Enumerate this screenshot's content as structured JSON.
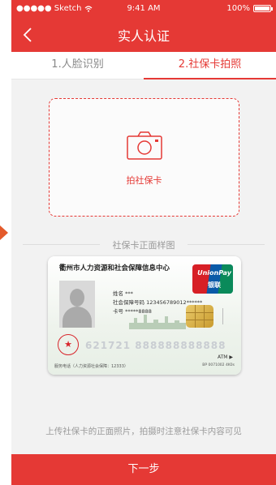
{
  "status_bar": {
    "carrier": "●●●●● Sketch",
    "time": "9:41 AM",
    "battery": "100%"
  },
  "nav": {
    "title": "实人认证"
  },
  "tabs": [
    {
      "label": "1.人脸识别",
      "active": false
    },
    {
      "label": "2.社保卡拍照",
      "active": true
    }
  ],
  "upload": {
    "label": "拍社保卡"
  },
  "sample": {
    "label": "社保卡正面样图",
    "card": {
      "issuer": "衢州市人力资源和社会保障信息中心",
      "unionpay_text": "UnionPay",
      "unionpay_cn": "银联",
      "name_line": "姓名 ***",
      "social_security_line": "社会保障号码 123456789012******",
      "card_no_line": "卡号 *****8888",
      "card_number": "621721 888888888888",
      "footer_left": "服务电话（人力资源社会保障：12333）",
      "atm": "ATM ▶",
      "footer_right": "BP 0071002 4K0s"
    }
  },
  "hint": "上传社保卡的正面照片，拍摄时注意社保卡内容可见",
  "next_button": "下一步",
  "colors": {
    "accent": "#e53935",
    "background": "#f2f2f2",
    "muted_text": "#9a9a9a"
  }
}
